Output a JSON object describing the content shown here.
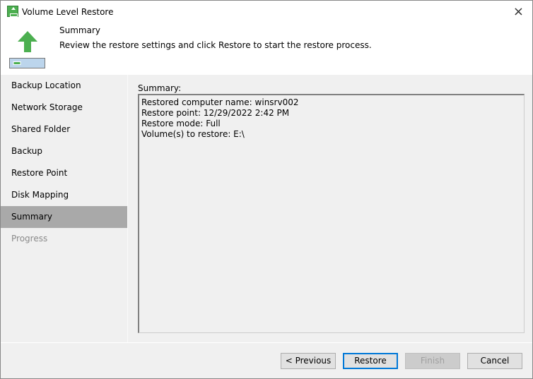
{
  "window": {
    "title": "Volume Level Restore",
    "close_icon": "×"
  },
  "header": {
    "title": "Summary",
    "description": "Review the restore settings and click Restore to start the restore process."
  },
  "nav": {
    "items": [
      {
        "label": "Backup Location"
      },
      {
        "label": "Network Storage"
      },
      {
        "label": "Shared Folder"
      },
      {
        "label": "Backup"
      },
      {
        "label": "Restore Point"
      },
      {
        "label": "Disk Mapping"
      },
      {
        "label": "Summary"
      },
      {
        "label": "Progress"
      }
    ]
  },
  "summary": {
    "label": "Summary:",
    "lines": [
      "Restored computer name: winsrv002",
      "Restore point: 12/29/2022 2:42 PM",
      "Restore mode: Full",
      "Volume(s) to restore: E:\\"
    ]
  },
  "buttons": {
    "previous": "< Previous",
    "restore": "Restore",
    "finish": "Finish",
    "cancel": "Cancel"
  },
  "colors": {
    "accent": "#0078d7",
    "icon_green": "#4caf50",
    "active_nav": "#a9a9a9"
  }
}
